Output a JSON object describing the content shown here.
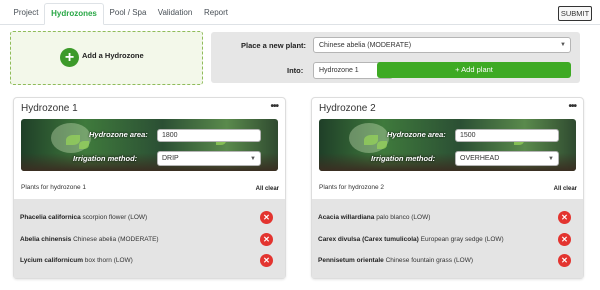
{
  "tabs": [
    "Project",
    "Hydrozones",
    "Pool / Spa",
    "Validation",
    "Report"
  ],
  "active_tab": "Hydrozones",
  "submit_label": "SUBMIT",
  "add_hydrozone_label": "Add a Hydrozone",
  "place": {
    "plant_label": "Place a new plant:",
    "plant_value": "Chinese abelia (MODERATE)",
    "into_label": "Into:",
    "into_value": "Hydrozone 1",
    "add_plant_label": "+ Add plant"
  },
  "hydrozones": [
    {
      "title": "Hydrozone 1",
      "menu": "•••",
      "area_label": "Hydrozone area:",
      "area_value": "1800",
      "irrigation_label": "Irrigation method:",
      "irrigation_value": "DRIP",
      "plants_label": "Plants for hydrozone 1",
      "all_clear": "All clear",
      "plants": [
        {
          "scientific": "Phacelia californica",
          "common": "scorpion flower (LOW)"
        },
        {
          "scientific": "Abelia chinensis",
          "common": "Chinese abelia (MODERATE)"
        },
        {
          "scientific": "Lycium californicum",
          "common": "box thorn (LOW)"
        }
      ]
    },
    {
      "title": "Hydrozone 2",
      "menu": "•••",
      "area_label": "Hydrozone area:",
      "area_value": "1500",
      "irrigation_label": "Irrigation method:",
      "irrigation_value": "OVERHEAD",
      "plants_label": "Plants for hydrozone 2",
      "all_clear": "All clear",
      "plants": [
        {
          "scientific": "Acacia willardiana",
          "common": "palo blanco (LOW)"
        },
        {
          "scientific": "Carex divulsa (Carex tumulicola)",
          "common": "European gray sedge (LOW)"
        },
        {
          "scientific": "Pennisetum orientale",
          "common": "Chinese fountain grass (LOW)"
        }
      ]
    }
  ],
  "icons": {
    "plus": "plus-icon",
    "delete": "close-icon",
    "menu": "more-icon",
    "dropdown": "chevron-down-icon"
  },
  "colors": {
    "accent": "#28a745",
    "add_button": "#3eaa24",
    "delete": "#e3342f"
  }
}
